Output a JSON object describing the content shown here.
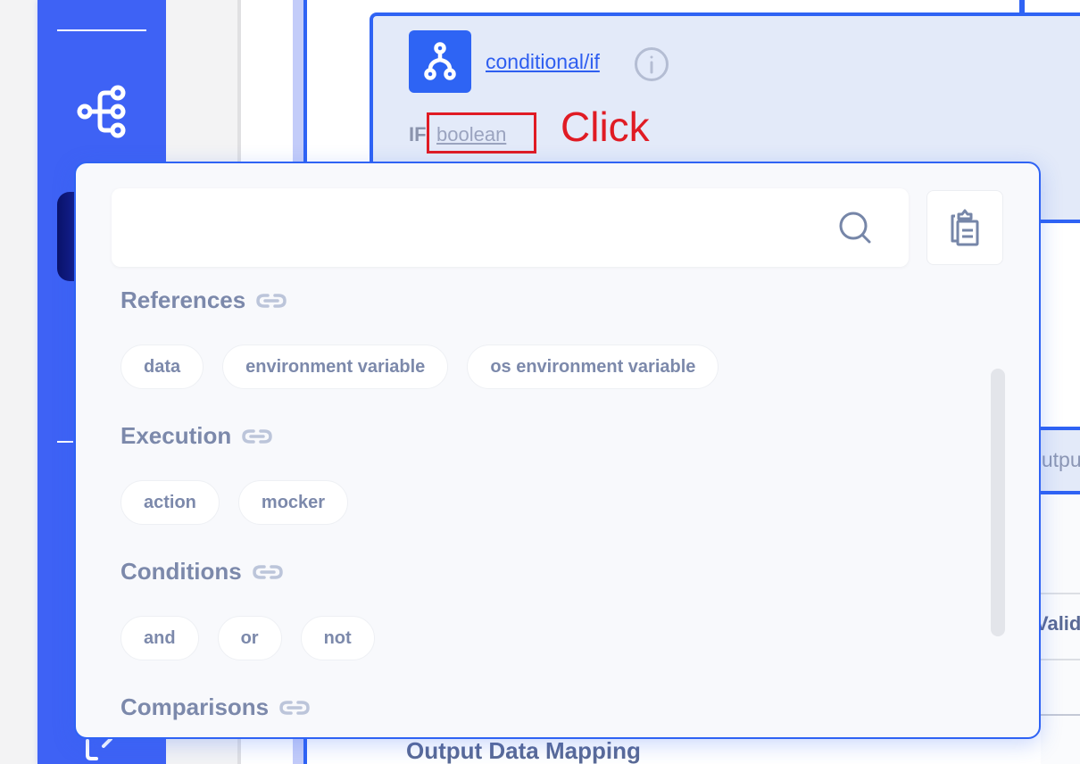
{
  "sidebar": {
    "icons": [
      "workflow-tree-icon",
      "exit-icon"
    ]
  },
  "node": {
    "title": "conditional/if",
    "icon": "branch-icon",
    "info_icon": "info-icon",
    "if_label": "IF",
    "if_value": "boolean"
  },
  "annotation": {
    "label": "Click"
  },
  "right_panels": {
    "output_bar_text": "Output",
    "validate_text": "Validate"
  },
  "output_mapping": {
    "title": "Output Data Mapping"
  },
  "popup": {
    "search": {
      "value": "",
      "placeholder": ""
    },
    "paste_button_icon": "clipboard-icon",
    "sections": [
      {
        "title": "References",
        "chips": [
          "data",
          "environment variable",
          "os environment variable"
        ]
      },
      {
        "title": "Execution",
        "chips": [
          "action",
          "mocker"
        ]
      },
      {
        "title": "Conditions",
        "chips": [
          "and",
          "or",
          "not"
        ]
      },
      {
        "title": "Comparisons",
        "chips": []
      }
    ]
  },
  "colors": {
    "accent": "#2f63f4",
    "sidebar": "#3e62f5",
    "chip_text": "#7c89ab",
    "annotation": "#e01b24",
    "node_bg": "#e3eaf9"
  }
}
